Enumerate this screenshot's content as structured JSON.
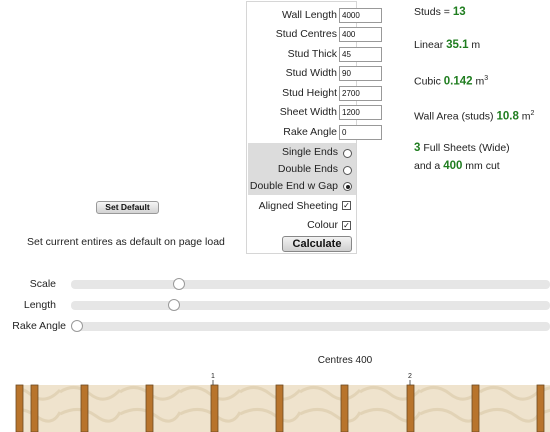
{
  "form": {
    "fields": [
      {
        "label": "Wall Length",
        "value": "4000"
      },
      {
        "label": "Stud Centres",
        "value": "400"
      },
      {
        "label": "Stud Thick",
        "value": "45"
      },
      {
        "label": "Stud Width",
        "value": "90"
      },
      {
        "label": "Stud Height",
        "value": "2700"
      },
      {
        "label": "Sheet Width",
        "value": "1200"
      },
      {
        "label": "Rake Angle",
        "value": "0"
      }
    ],
    "ends": [
      {
        "label": "Single Ends",
        "selected": false
      },
      {
        "label": "Double Ends",
        "selected": false
      },
      {
        "label": "Double End w Gap",
        "selected": true
      }
    ],
    "options": [
      {
        "label": "Aligned Sheeting",
        "checked": true,
        "mark": "✓"
      },
      {
        "label": "Colour",
        "checked": true,
        "mark": "✓"
      }
    ],
    "calculate_label": "Calculate"
  },
  "results": {
    "studs_label": "Studs = ",
    "studs_value": "13",
    "linear_label": "Linear ",
    "linear_value": "35.1",
    "linear_unit": " m",
    "cubic_label": "Cubic ",
    "cubic_value": "0.142",
    "cubic_unit": " m",
    "cubic_sup": "3",
    "area_label": "Wall Area (studs) ",
    "area_value": "10.8",
    "area_unit": " m",
    "area_sup": "2",
    "sheets_value": "3",
    "sheets_text": " Full Sheets (Wide)",
    "cut_prefix": "and a ",
    "cut_value": "400",
    "cut_suffix": " mm cut"
  },
  "defaults": {
    "button_label": "Set Default",
    "description": "Set current entires as default on page load"
  },
  "sliders": [
    {
      "label": "Scale",
      "level": 0.218
    },
    {
      "label": "Length",
      "level": 0.208
    },
    {
      "label": "Rake Angle",
      "level": 0.0
    }
  ],
  "diagram": {
    "centres_label": "Centres 400",
    "sheet_markers": [
      "1",
      "2"
    ],
    "colors": {
      "sheet": "#efe3cd",
      "stud": "#b8742c",
      "stud_edge": "#6e4a22",
      "joint": "#c9b89a"
    }
  }
}
